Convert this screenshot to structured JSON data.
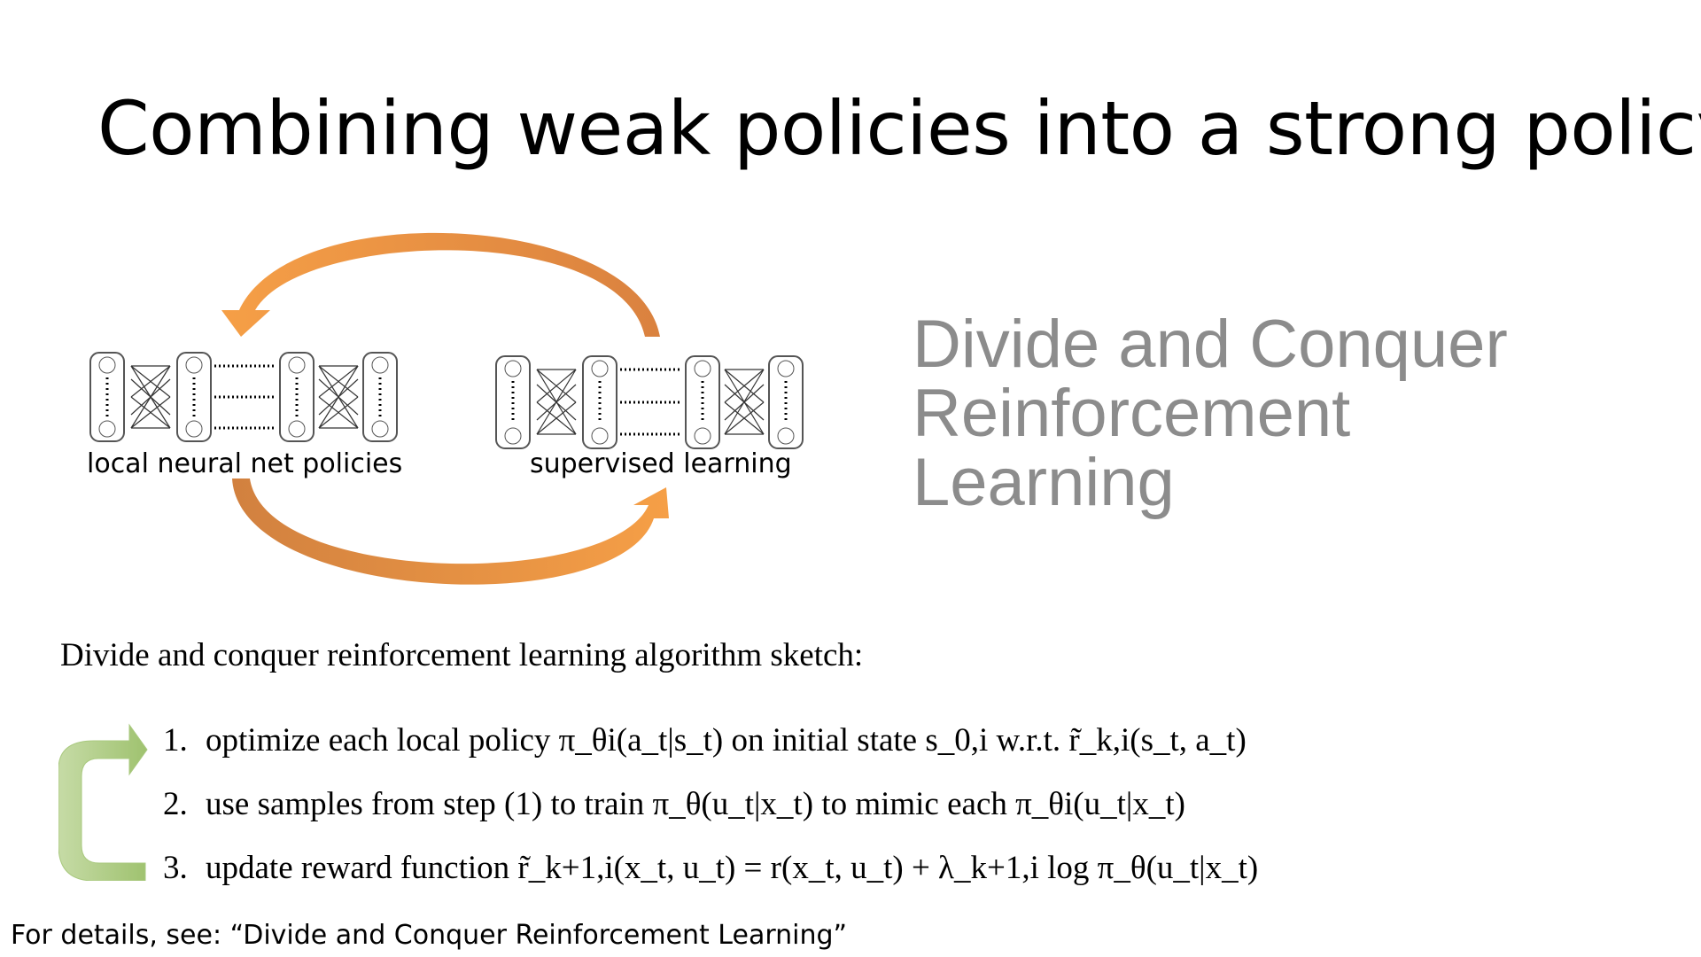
{
  "slide": {
    "title": "Combining weak policies into a strong policy",
    "heading_lines": [
      "Divide and Conquer",
      "Reinforcement",
      "Learning"
    ],
    "diagram": {
      "left_label": "local neural net policies",
      "right_label": "supervised learning",
      "arrow_color": "#f39a4a"
    },
    "sketch_intro": "Divide and conquer reinforcement learning algorithm sketch:",
    "steps": [
      {
        "num": "1.",
        "text": "optimize each local policy π_θi(a_t|s_t) on initial state s_0,i w.r.t. r̃_k,i(s_t, a_t)"
      },
      {
        "num": "2.",
        "text": "use samples from step (1) to train π_θ(u_t|x_t) to mimic each π_θi(u_t|x_t)"
      },
      {
        "num": "3.",
        "text": "update reward function r̃_k+1,i(x_t, u_t) = r(x_t, u_t) + λ_k+1,i log π_θ(u_t|x_t)"
      }
    ],
    "loop_arrow_color": "#a9c97f",
    "footer": "For details, see: “Divide and Conquer Reinforcement Learning”"
  }
}
